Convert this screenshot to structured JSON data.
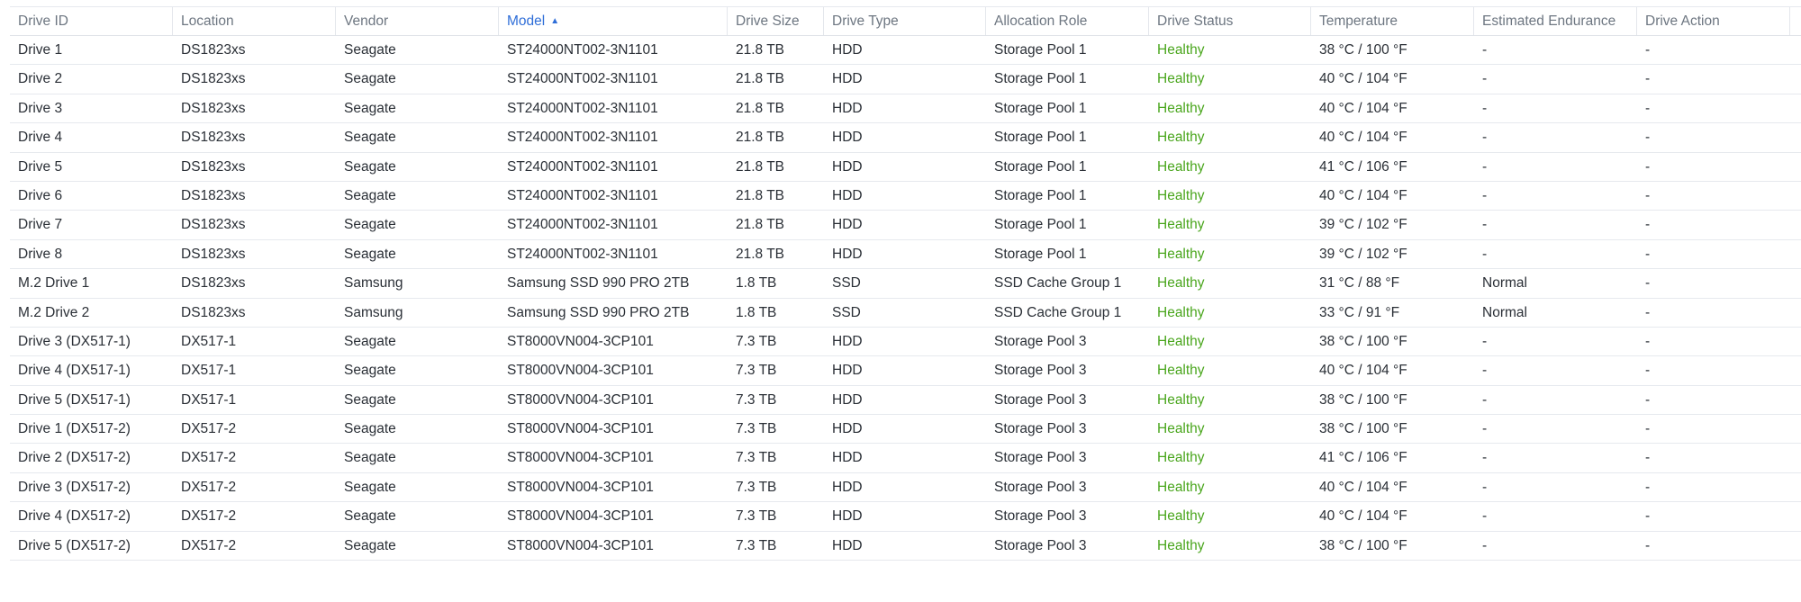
{
  "columns": [
    "Drive ID",
    "Location",
    "Vendor",
    "Model",
    "Drive Size",
    "Drive Type",
    "Allocation Role",
    "Drive Status",
    "Temperature",
    "Estimated Endurance",
    "Drive Action"
  ],
  "sort": {
    "column": "Model",
    "direction": "ascending",
    "icon": "sort-ascending-icon",
    "color": "#2f6ed8"
  },
  "status_color": "#4aa61d",
  "menu_icon": "vertical-dots-icon",
  "rows": [
    {
      "drive_id": "Drive 1",
      "location": "DS1823xs",
      "vendor": "Seagate",
      "model": "ST24000NT002-3N1101",
      "size": "21.8 TB",
      "type": "HDD",
      "role": "Storage Pool 1",
      "status": "Healthy",
      "temperature": "38 °C / 100 °F",
      "endurance": "-",
      "action": "-"
    },
    {
      "drive_id": "Drive 2",
      "location": "DS1823xs",
      "vendor": "Seagate",
      "model": "ST24000NT002-3N1101",
      "size": "21.8 TB",
      "type": "HDD",
      "role": "Storage Pool 1",
      "status": "Healthy",
      "temperature": "40 °C / 104 °F",
      "endurance": "-",
      "action": "-"
    },
    {
      "drive_id": "Drive 3",
      "location": "DS1823xs",
      "vendor": "Seagate",
      "model": "ST24000NT002-3N1101",
      "size": "21.8 TB",
      "type": "HDD",
      "role": "Storage Pool 1",
      "status": "Healthy",
      "temperature": "40 °C / 104 °F",
      "endurance": "-",
      "action": "-"
    },
    {
      "drive_id": "Drive 4",
      "location": "DS1823xs",
      "vendor": "Seagate",
      "model": "ST24000NT002-3N1101",
      "size": "21.8 TB",
      "type": "HDD",
      "role": "Storage Pool 1",
      "status": "Healthy",
      "temperature": "40 °C / 104 °F",
      "endurance": "-",
      "action": "-"
    },
    {
      "drive_id": "Drive 5",
      "location": "DS1823xs",
      "vendor": "Seagate",
      "model": "ST24000NT002-3N1101",
      "size": "21.8 TB",
      "type": "HDD",
      "role": "Storage Pool 1",
      "status": "Healthy",
      "temperature": "41 °C / 106 °F",
      "endurance": "-",
      "action": "-"
    },
    {
      "drive_id": "Drive 6",
      "location": "DS1823xs",
      "vendor": "Seagate",
      "model": "ST24000NT002-3N1101",
      "size": "21.8 TB",
      "type": "HDD",
      "role": "Storage Pool 1",
      "status": "Healthy",
      "temperature": "40 °C / 104 °F",
      "endurance": "-",
      "action": "-"
    },
    {
      "drive_id": "Drive 7",
      "location": "DS1823xs",
      "vendor": "Seagate",
      "model": "ST24000NT002-3N1101",
      "size": "21.8 TB",
      "type": "HDD",
      "role": "Storage Pool 1",
      "status": "Healthy",
      "temperature": "39 °C / 102 °F",
      "endurance": "-",
      "action": "-"
    },
    {
      "drive_id": "Drive 8",
      "location": "DS1823xs",
      "vendor": "Seagate",
      "model": "ST24000NT002-3N1101",
      "size": "21.8 TB",
      "type": "HDD",
      "role": "Storage Pool 1",
      "status": "Healthy",
      "temperature": "39 °C / 102 °F",
      "endurance": "-",
      "action": "-"
    },
    {
      "drive_id": "M.2 Drive 1",
      "location": "DS1823xs",
      "vendor": "Samsung",
      "model": "Samsung SSD 990 PRO 2TB",
      "size": "1.8 TB",
      "type": "SSD",
      "role": "SSD Cache Group 1",
      "status": "Healthy",
      "temperature": "31 °C / 88 °F",
      "endurance": "Normal",
      "action": "-"
    },
    {
      "drive_id": "M.2 Drive 2",
      "location": "DS1823xs",
      "vendor": "Samsung",
      "model": "Samsung SSD 990 PRO 2TB",
      "size": "1.8 TB",
      "type": "SSD",
      "role": "SSD Cache Group 1",
      "status": "Healthy",
      "temperature": "33 °C / 91 °F",
      "endurance": "Normal",
      "action": "-"
    },
    {
      "drive_id": "Drive 3 (DX517-1)",
      "location": "DX517-1",
      "vendor": "Seagate",
      "model": "ST8000VN004-3CP101",
      "size": "7.3 TB",
      "type": "HDD",
      "role": "Storage Pool 3",
      "status": "Healthy",
      "temperature": "38 °C / 100 °F",
      "endurance": "-",
      "action": "-"
    },
    {
      "drive_id": "Drive 4 (DX517-1)",
      "location": "DX517-1",
      "vendor": "Seagate",
      "model": "ST8000VN004-3CP101",
      "size": "7.3 TB",
      "type": "HDD",
      "role": "Storage Pool 3",
      "status": "Healthy",
      "temperature": "40 °C / 104 °F",
      "endurance": "-",
      "action": "-"
    },
    {
      "drive_id": "Drive 5 (DX517-1)",
      "location": "DX517-1",
      "vendor": "Seagate",
      "model": "ST8000VN004-3CP101",
      "size": "7.3 TB",
      "type": "HDD",
      "role": "Storage Pool 3",
      "status": "Healthy",
      "temperature": "38 °C / 100 °F",
      "endurance": "-",
      "action": "-"
    },
    {
      "drive_id": "Drive 1 (DX517-2)",
      "location": "DX517-2",
      "vendor": "Seagate",
      "model": "ST8000VN004-3CP101",
      "size": "7.3 TB",
      "type": "HDD",
      "role": "Storage Pool 3",
      "status": "Healthy",
      "temperature": "38 °C / 100 °F",
      "endurance": "-",
      "action": "-"
    },
    {
      "drive_id": "Drive 2 (DX517-2)",
      "location": "DX517-2",
      "vendor": "Seagate",
      "model": "ST8000VN004-3CP101",
      "size": "7.3 TB",
      "type": "HDD",
      "role": "Storage Pool 3",
      "status": "Healthy",
      "temperature": "41 °C / 106 °F",
      "endurance": "-",
      "action": "-"
    },
    {
      "drive_id": "Drive 3 (DX517-2)",
      "location": "DX517-2",
      "vendor": "Seagate",
      "model": "ST8000VN004-3CP101",
      "size": "7.3 TB",
      "type": "HDD",
      "role": "Storage Pool 3",
      "status": "Healthy",
      "temperature": "40 °C / 104 °F",
      "endurance": "-",
      "action": "-"
    },
    {
      "drive_id": "Drive 4 (DX517-2)",
      "location": "DX517-2",
      "vendor": "Seagate",
      "model": "ST8000VN004-3CP101",
      "size": "7.3 TB",
      "type": "HDD",
      "role": "Storage Pool 3",
      "status": "Healthy",
      "temperature": "40 °C / 104 °F",
      "endurance": "-",
      "action": "-"
    },
    {
      "drive_id": "Drive 5 (DX517-2)",
      "location": "DX517-2",
      "vendor": "Seagate",
      "model": "ST8000VN004-3CP101",
      "size": "7.3 TB",
      "type": "HDD",
      "role": "Storage Pool 3",
      "status": "Healthy",
      "temperature": "38 °C / 100 °F",
      "endurance": "-",
      "action": "-"
    }
  ]
}
